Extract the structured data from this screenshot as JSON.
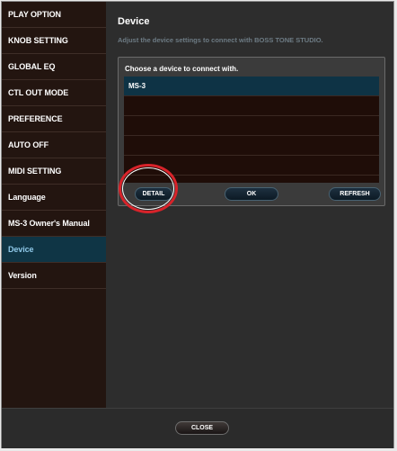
{
  "sidebar": {
    "items": [
      {
        "label": "PLAY OPTION"
      },
      {
        "label": "KNOB SETTING"
      },
      {
        "label": "GLOBAL EQ"
      },
      {
        "label": "CTL OUT MODE"
      },
      {
        "label": "PREFERENCE"
      },
      {
        "label": "AUTO OFF"
      },
      {
        "label": "MIDI SETTING"
      },
      {
        "label": "Language"
      },
      {
        "label": "MS-3 Owner's Manual"
      },
      {
        "label": "Device"
      },
      {
        "label": "Version"
      }
    ],
    "active_index": 9
  },
  "main": {
    "title": "Device",
    "subtitle": "Adjust the device settings to connect with BOSS TONE STUDIO."
  },
  "dialog": {
    "header": "Choose a device to connect with.",
    "devices": [
      "MS-3",
      "",
      "",
      "",
      ""
    ],
    "selected_index": 0,
    "buttons": {
      "detail": "DETAIL",
      "ok": "OK",
      "refresh": "REFRESH"
    }
  },
  "footer": {
    "close_label": "CLOSE"
  },
  "colors": {
    "accent": "#0f3545",
    "highlight": "#d8232a"
  }
}
